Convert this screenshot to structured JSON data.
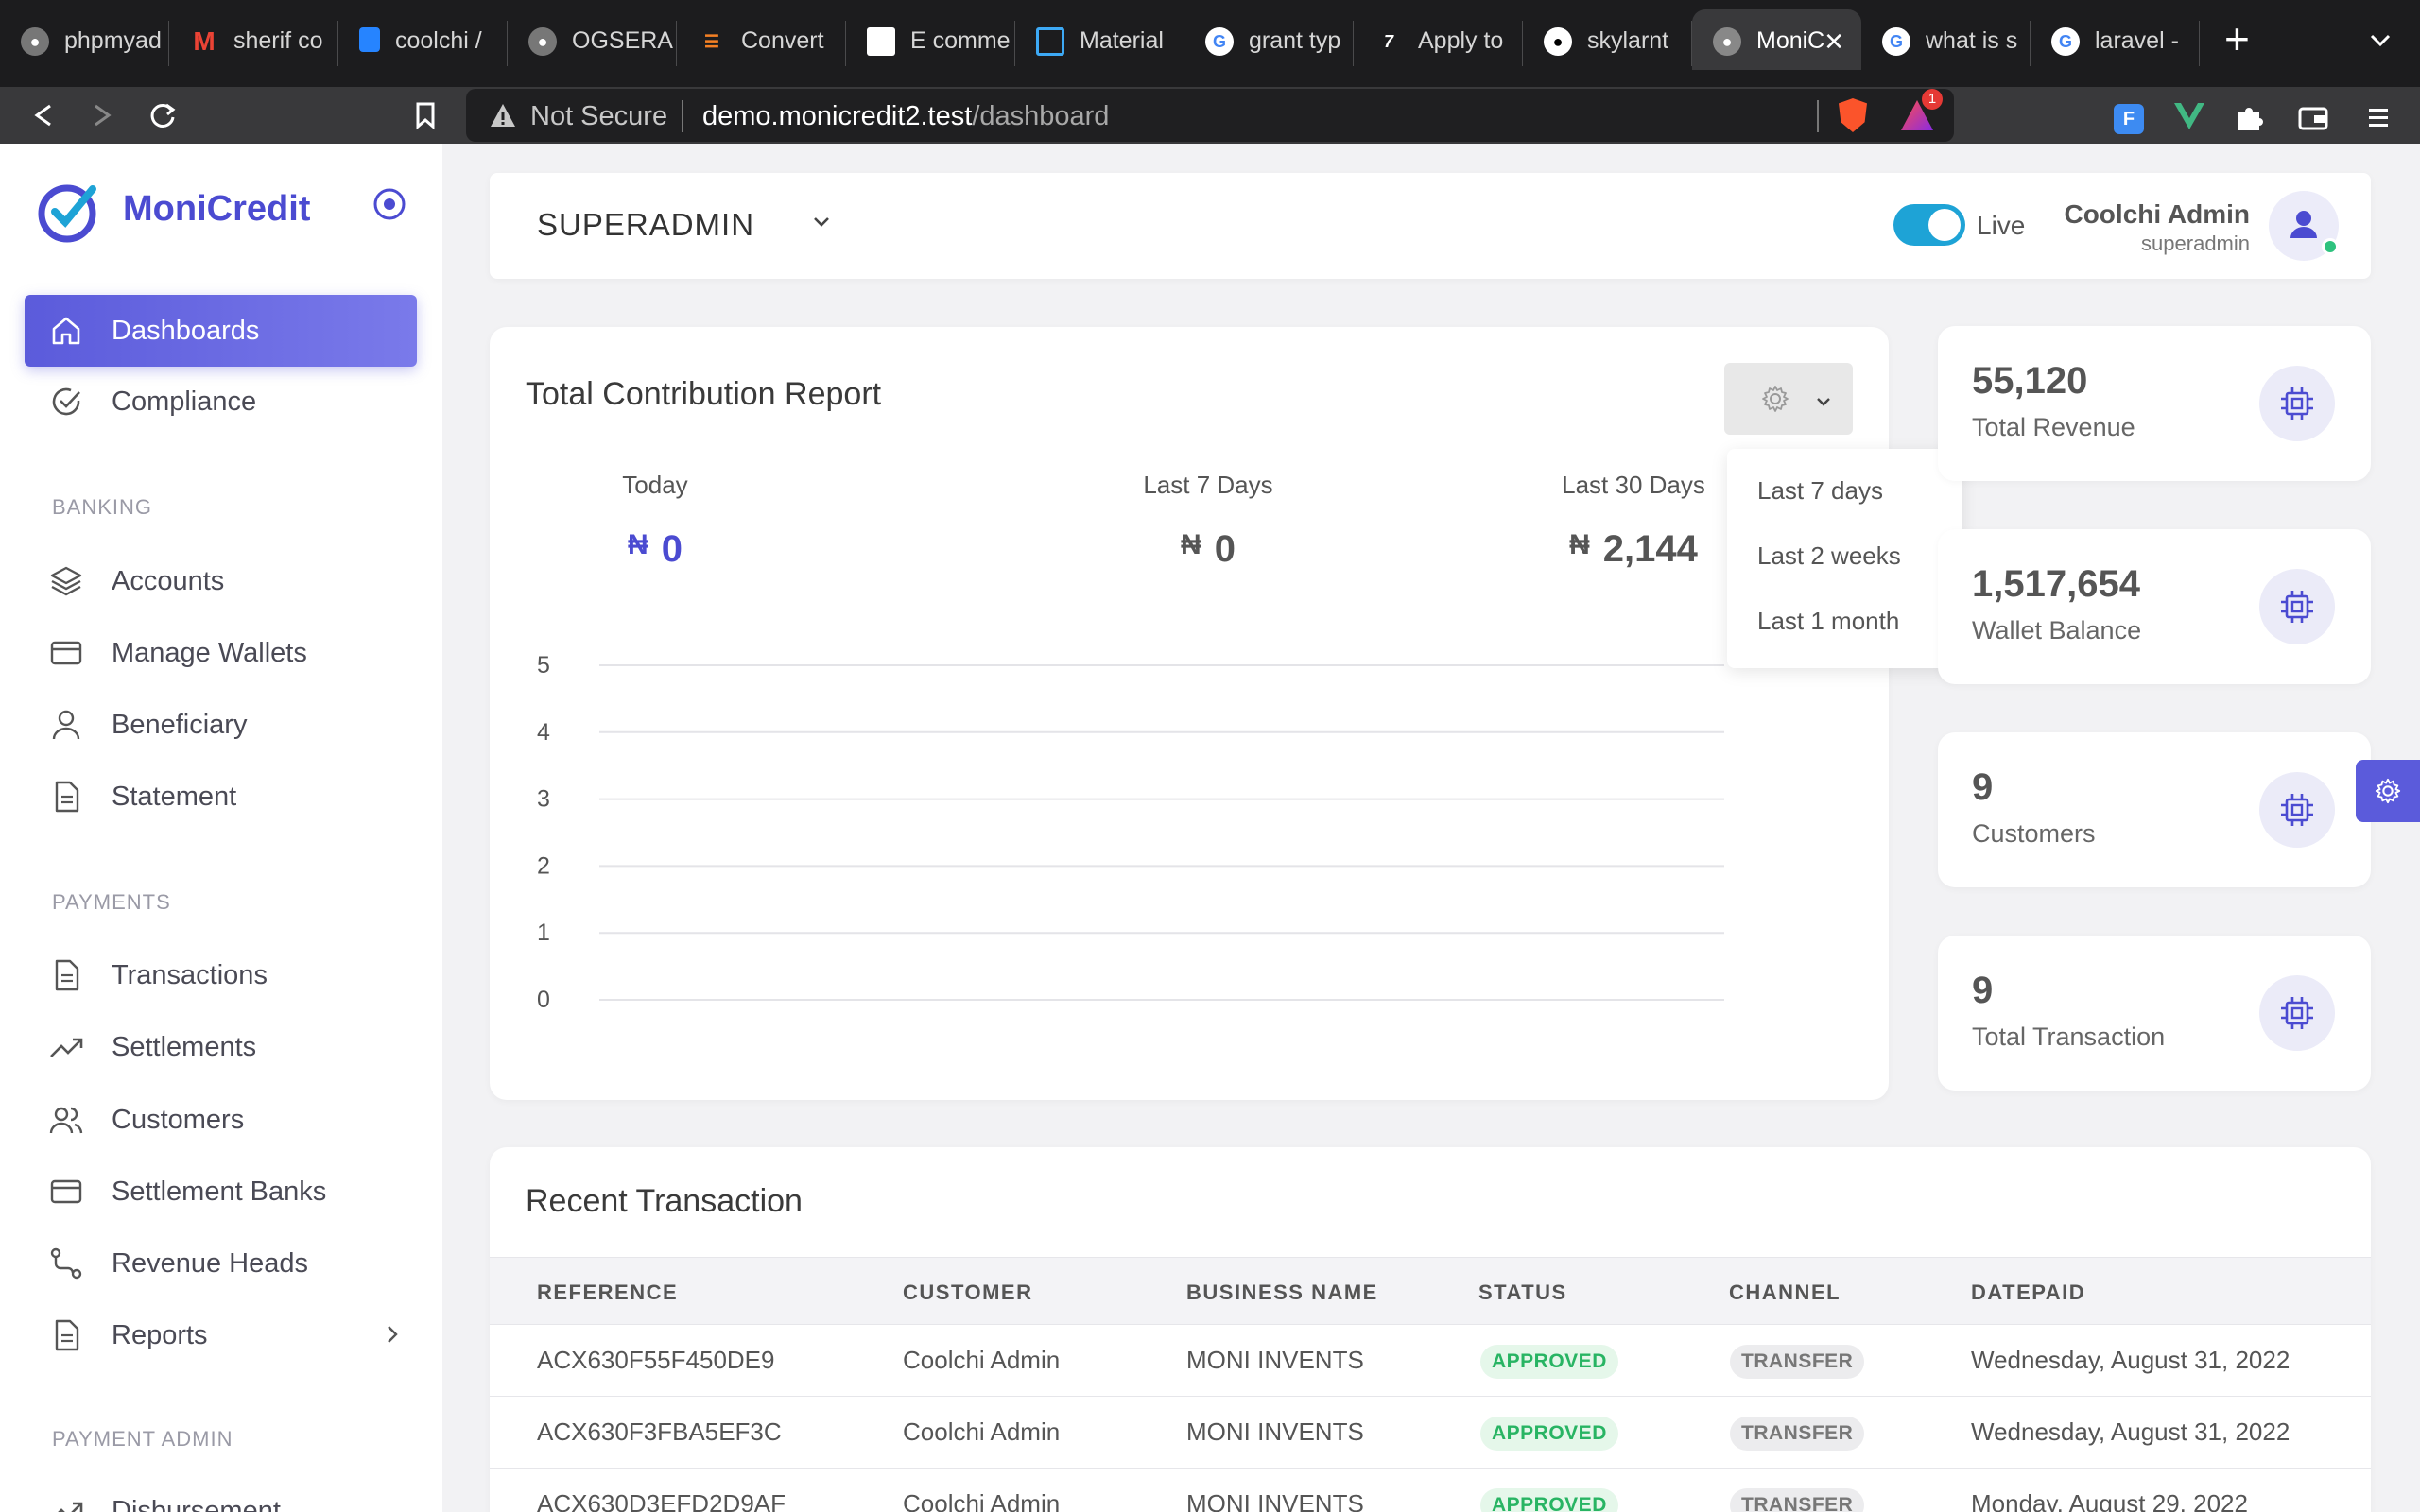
{
  "browser": {
    "tabs": [
      {
        "title": "phpmyad",
        "icon": "php-favicon-icon"
      },
      {
        "title": "sherif co",
        "icon": "gmail-icon"
      },
      {
        "title": "coolchi /",
        "icon": "bitbucket-icon"
      },
      {
        "title": "OGSERA",
        "icon": "globe-icon"
      },
      {
        "title": "Convert",
        "icon": "stackoverflow-icon"
      },
      {
        "title": "E comme",
        "icon": "ecommerce-icon"
      },
      {
        "title": "Material",
        "icon": "material-icon"
      },
      {
        "title": "grant typ",
        "icon": "google-icon"
      },
      {
        "title": "Apply to",
        "icon": "apply-icon"
      },
      {
        "title": "skylarnt",
        "icon": "github-icon"
      },
      {
        "title": "MoniC",
        "icon": "globe-icon",
        "active": true
      },
      {
        "title": "what is s",
        "icon": "google-icon"
      },
      {
        "title": "laravel -",
        "icon": "google-icon"
      }
    ],
    "not_secure": "Not Secure",
    "url_host": "demo.monicredit2.test",
    "url_path": "/dashboard",
    "alert_count": "1"
  },
  "sidebar": {
    "brand": "MoniCredit",
    "items_main": [
      {
        "label": "Dashboards",
        "icon": "home-icon"
      },
      {
        "label": "Compliance",
        "icon": "check-circle-icon"
      }
    ],
    "banking_title": "BANKING",
    "banking": [
      {
        "label": "Accounts",
        "icon": "layers-icon"
      },
      {
        "label": "Manage Wallets",
        "icon": "credit-card-icon"
      },
      {
        "label": "Beneficiary",
        "icon": "user-icon"
      },
      {
        "label": "Statement",
        "icon": "document-icon"
      }
    ],
    "payments_title": "PAYMENTS",
    "payments": [
      {
        "label": "Transactions",
        "icon": "document-icon"
      },
      {
        "label": "Settlements",
        "icon": "trending-up-icon"
      },
      {
        "label": "Customers",
        "icon": "users-icon"
      },
      {
        "label": "Settlement Banks",
        "icon": "credit-card-icon"
      },
      {
        "label": "Revenue Heads",
        "icon": "route-icon"
      },
      {
        "label": "Reports",
        "icon": "document-icon"
      }
    ],
    "payment_admin_title": "PAYMENT ADMIN",
    "payment_admin": [
      {
        "label": "Disbursement",
        "icon": "trending-up-icon"
      }
    ]
  },
  "header": {
    "role": "SUPERADMIN",
    "live_label": "Live",
    "user_name": "Coolchi Admin",
    "user_role": "superadmin"
  },
  "report": {
    "title": "Total Contribution Report",
    "currency": "₦",
    "stats": [
      {
        "label": "Today",
        "value": "0",
        "color": "#4b4bd1"
      },
      {
        "label": "Last 7 Days",
        "value": "0",
        "color": "#555555"
      },
      {
        "label": "Last 30 Days",
        "value": "2,144",
        "color": "#555555"
      }
    ],
    "dropdown": [
      "Last 7 days",
      "Last 2 weeks",
      "Last 1 month"
    ]
  },
  "chart_data": {
    "type": "line",
    "x": [],
    "series": [],
    "yticks": [
      "0",
      "1",
      "2",
      "3",
      "4",
      "5"
    ],
    "ylim": [
      0,
      5
    ],
    "grid": true
  },
  "metrics": [
    {
      "value": "55,120",
      "label": "Total Revenue"
    },
    {
      "value": "1,517,654",
      "label": "Wallet Balance"
    },
    {
      "value": "9",
      "label": "Customers"
    },
    {
      "value": "9",
      "label": "Total Transaction"
    }
  ],
  "transactions": {
    "title": "Recent Transaction",
    "columns": [
      "REFERENCE",
      "CUSTOMER",
      "BUSINESS NAME",
      "STATUS",
      "CHANNEL",
      "DATEPAID"
    ],
    "rows": [
      {
        "reference": "ACX630F55F450DE9",
        "customer": "Coolchi Admin",
        "business": "MONI INVENTS",
        "status": "APPROVED",
        "channel": "TRANSFER",
        "date": "Wednesday, August 31, 2022"
      },
      {
        "reference": "ACX630F3FBA5EF3C",
        "customer": "Coolchi Admin",
        "business": "MONI INVENTS",
        "status": "APPROVED",
        "channel": "TRANSFER",
        "date": "Wednesday, August 31, 2022"
      },
      {
        "reference": "ACX630D3EFD2D9AF",
        "customer": "Coolchi Admin",
        "business": "MONI INVENTS",
        "status": "APPROVED",
        "channel": "TRANSFER",
        "date": "Monday, August 29, 2022"
      }
    ]
  },
  "colors": {
    "accent": "#5b5bdb",
    "brand": "#4b4bd1",
    "toggle": "#1ea3d6",
    "success": "#28b463"
  }
}
